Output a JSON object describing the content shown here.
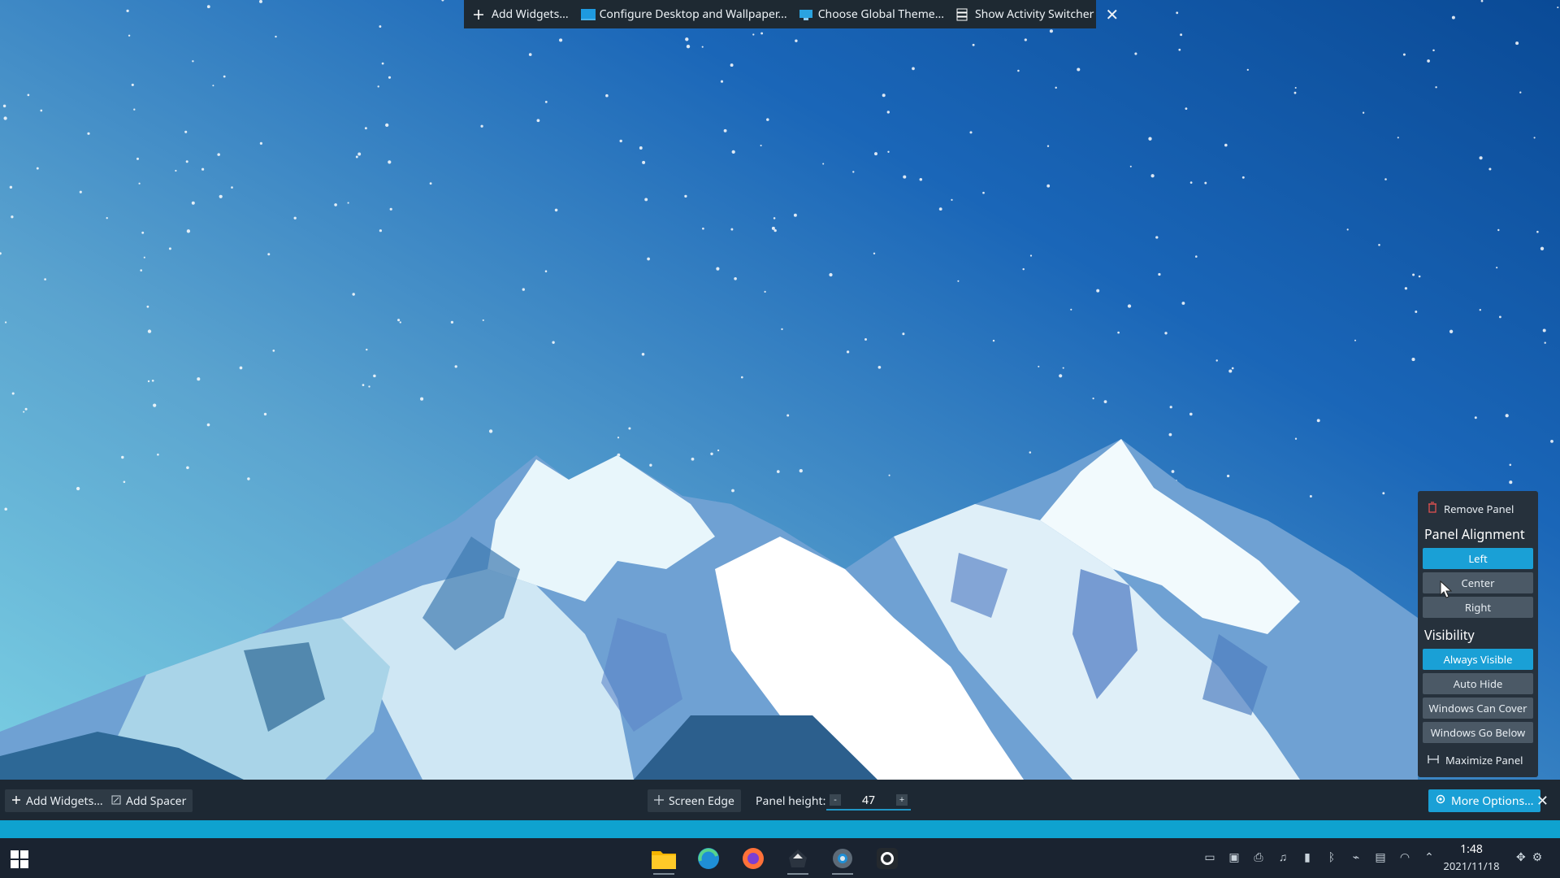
{
  "toolbox": {
    "add_widgets": "Add Widgets...",
    "configure_desktop": "Configure Desktop and Wallpaper...",
    "choose_theme": "Choose Global Theme...",
    "activity_switcher": "Show Activity Switcher",
    "close": "✕"
  },
  "panel_config": {
    "add_widgets": "Add Widgets...",
    "add_spacer": "Add Spacer",
    "screen_edge": "Screen Edge",
    "panel_height_label": "Panel height:",
    "minus": "-",
    "plus": "+",
    "panel_height_value": "47",
    "more_options": "More Options...",
    "close": "✕"
  },
  "popup": {
    "remove_panel": "Remove Panel",
    "alignment_heading": "Panel Alignment",
    "alignment": [
      "Left",
      "Center",
      "Right"
    ],
    "alignment_selected": "Left",
    "visibility_heading": "Visibility",
    "visibility": [
      "Always Visible",
      "Auto Hide",
      "Windows Can Cover",
      "Windows Go Below"
    ],
    "visibility_selected": "Always Visible",
    "maximize_panel": "Maximize Panel"
  },
  "taskbar": {
    "apps": [
      "file-manager",
      "edge-dev",
      "firefox",
      "vpn-app",
      "system-settings",
      "github-desktop"
    ],
    "clock": {
      "time": "1:48",
      "date": "2021/11/18"
    }
  },
  "colors": {
    "accent": "#1aa0d6",
    "panel": "#1d2833",
    "stripe": "#0fa2cf"
  }
}
